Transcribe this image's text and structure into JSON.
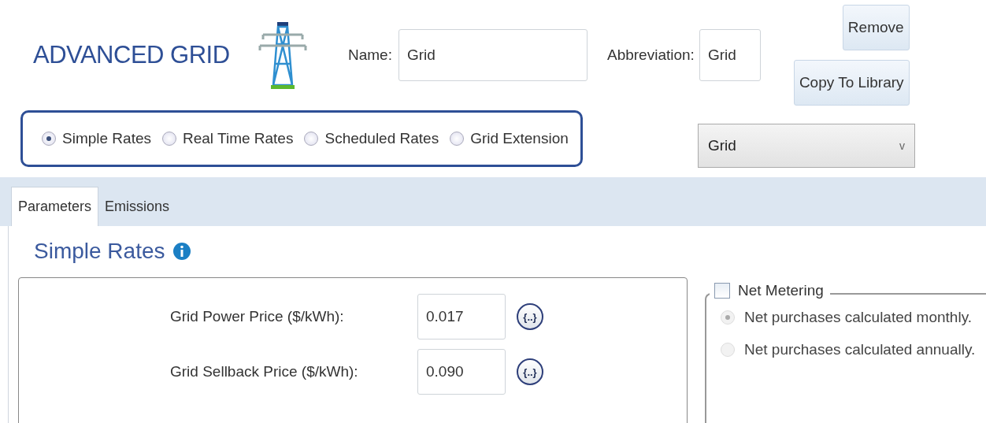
{
  "title": "ADVANCED GRID",
  "name": {
    "label": "Name:",
    "value": "Grid"
  },
  "abbreviation": {
    "label": "Abbreviation:",
    "value": "Grid"
  },
  "buttons": [
    {
      "label": "Remove"
    },
    {
      "label": "Copy To Library"
    }
  ],
  "rate_types": [
    {
      "label": "Simple Rates",
      "selected": true
    },
    {
      "label": "Real Time Rates",
      "selected": false
    },
    {
      "label": "Scheduled Rates",
      "selected": false
    },
    {
      "label": "Grid Extension",
      "selected": false
    }
  ],
  "dropdown": {
    "value": "Grid",
    "caret": "v"
  },
  "tabs": [
    {
      "label": "Parameters",
      "selected": true
    },
    {
      "label": "Emissions",
      "selected": false
    }
  ],
  "section_title": "Simple Rates",
  "fields": [
    {
      "label": "Grid Power Price ($/kWh):",
      "value": "0.017",
      "button": "{..}"
    },
    {
      "label": "Grid Sellback Price ($/kWh):",
      "value": "0.090",
      "button": "{..}"
    }
  ],
  "net_metering": {
    "label": "Net Metering",
    "checked": false,
    "options": [
      {
        "label": "Net purchases calculated monthly.",
        "selected": true,
        "disabled": true
      },
      {
        "label": "Net purchases calculated annually.",
        "selected": false,
        "disabled": true
      }
    ]
  }
}
